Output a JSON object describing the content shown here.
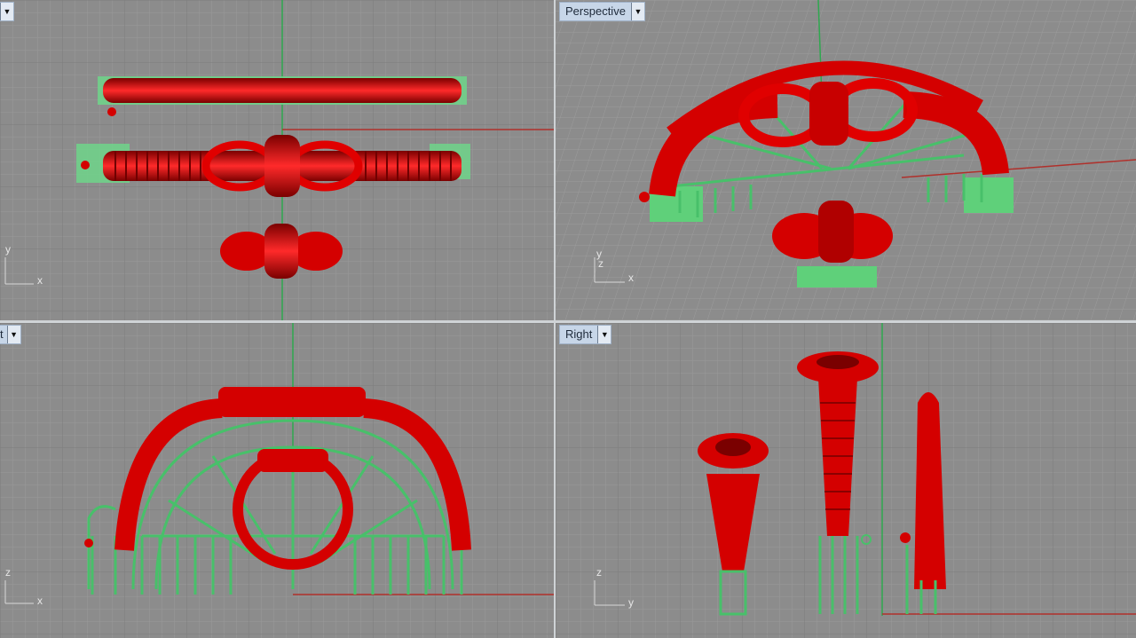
{
  "viewports": {
    "top_left": {
      "title": ""
    },
    "perspective": {
      "title": "Perspective"
    },
    "bottom_left": {
      "title": "t"
    },
    "right": {
      "title": "Right"
    }
  },
  "axes": {
    "x": "x",
    "y": "y",
    "z": "z"
  },
  "icons": {
    "dropdown": "chevron-down-icon"
  },
  "colors": {
    "viewport_bg": "#8c8c8c",
    "grid_minor": "#9a9a9a",
    "grid_major": "#7c7c7c",
    "axis_green": "#2fa84f",
    "axis_red": "#b0302b",
    "model_red": "#d40000",
    "support_green": "#5fd07a"
  }
}
